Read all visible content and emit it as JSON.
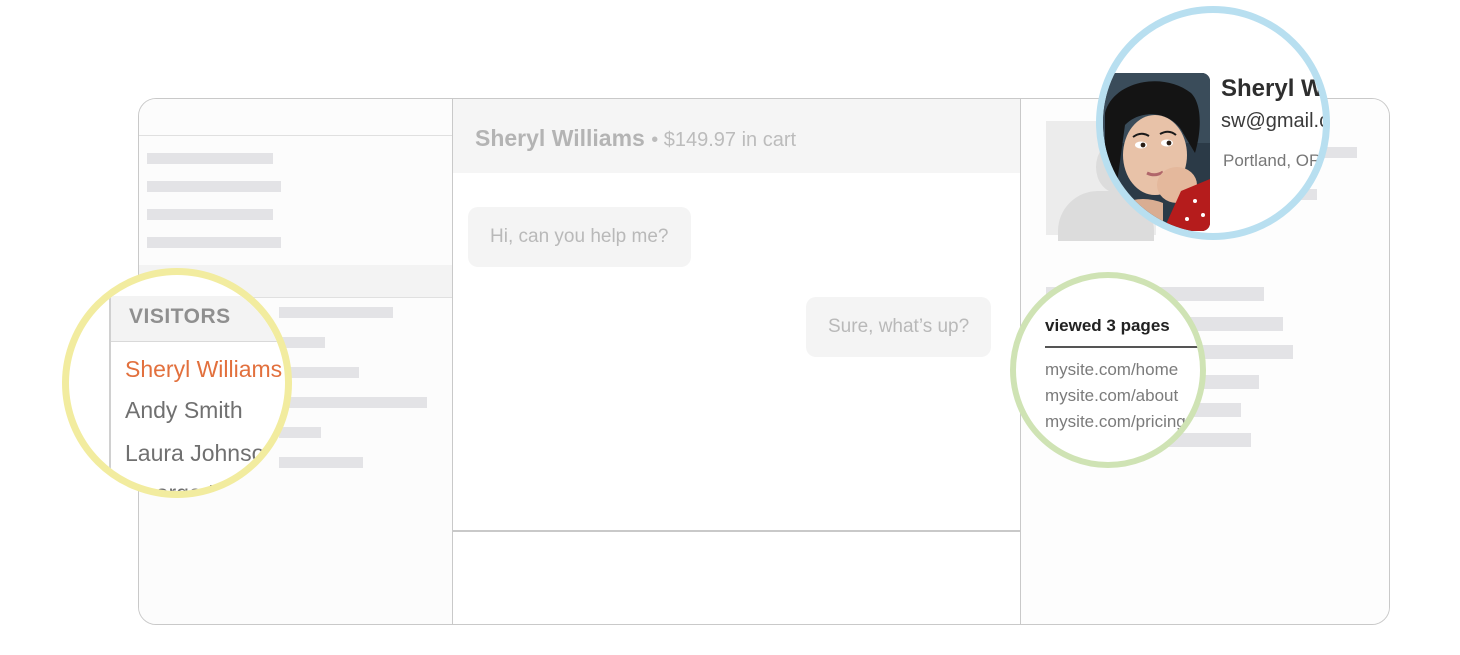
{
  "conversation": {
    "visitor_name": "Sheryl Williams",
    "cart_text": "• $149.97 in cart"
  },
  "messages": [
    {
      "from": "visitor",
      "text": "Hi, can you help me?"
    },
    {
      "from": "agent",
      "text": "Sure, what’s up?"
    }
  ],
  "visitors": {
    "heading": "VISITORS",
    "items": [
      {
        "name": "Sheryl Williams",
        "active": true
      },
      {
        "name": "Andy Smith",
        "active": false
      },
      {
        "name": "Laura Johnson",
        "active": false
      },
      {
        "name": "George H",
        "active": false
      }
    ]
  },
  "page_views": {
    "title": "viewed 3 pages",
    "pages": [
      "mysite.com/home",
      "mysite.com/about",
      "mysite.com/pricing"
    ]
  },
  "profile": {
    "name": "Sheryl Williams",
    "email": "sw@gmail.com",
    "location": "Portland, OR"
  },
  "colors": {
    "active_visitor": "#e2703d",
    "visitors_ring": "#f2ec9f",
    "pages_ring": "#cfe3b4",
    "profile_ring": "#b8dff0"
  }
}
